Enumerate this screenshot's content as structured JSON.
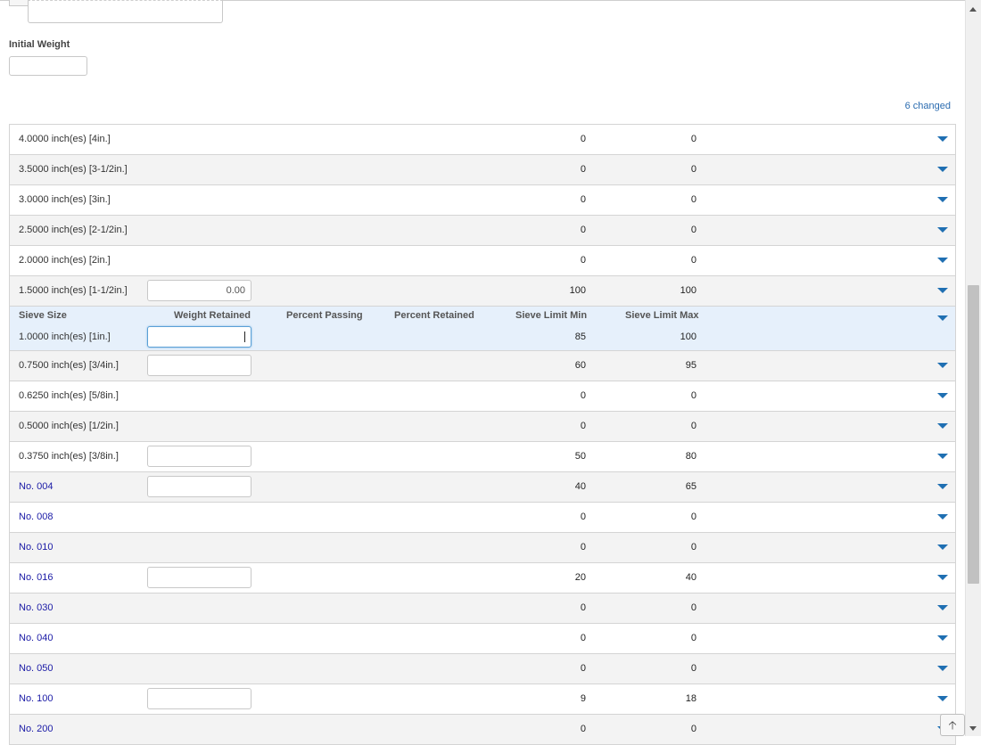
{
  "form": {
    "initial_weight_label": "Initial Weight",
    "initial_weight_value": "",
    "changed_text": "6 changed"
  },
  "table": {
    "headers": {
      "sieve_size": "Sieve Size",
      "weight_retained": "Weight Retained",
      "percent_passing": "Percent Passing",
      "percent_retained": "Percent Retained",
      "sieve_limit_min": "Sieve Limit Min",
      "sieve_limit_max": "Sieve Limit Max"
    },
    "rows": [
      {
        "size": "4.0000 inch(es) [4in.]",
        "input": null,
        "min": "0",
        "max": "0"
      },
      {
        "size": "3.5000 inch(es) [3-1/2in.]",
        "input": null,
        "min": "0",
        "max": "0"
      },
      {
        "size": "3.0000 inch(es) [3in.]",
        "input": null,
        "min": "0",
        "max": "0"
      },
      {
        "size": "2.5000 inch(es) [2-1/2in.]",
        "input": null,
        "min": "0",
        "max": "0"
      },
      {
        "size": "2.0000 inch(es) [2in.]",
        "input": null,
        "min": "0",
        "max": "0"
      },
      {
        "size": "1.5000 inch(es) [1-1/2in.]",
        "input": "0.00",
        "min": "100",
        "max": "100"
      },
      {
        "size": "1.0000 inch(es) [1in.]",
        "input": "",
        "min": "85",
        "max": "100"
      },
      {
        "size": "0.7500 inch(es) [3/4in.]",
        "input": "",
        "min": "60",
        "max": "95"
      },
      {
        "size": "0.6250 inch(es) [5/8in.]",
        "input": null,
        "min": "0",
        "max": "0"
      },
      {
        "size": "0.5000 inch(es) [1/2in.]",
        "input": null,
        "min": "0",
        "max": "0"
      },
      {
        "size": "0.3750 inch(es) [3/8in.]",
        "input": "",
        "min": "50",
        "max": "80"
      },
      {
        "size": "No. 004",
        "input": "",
        "min": "40",
        "max": "65"
      },
      {
        "size": "No. 008",
        "input": null,
        "min": "0",
        "max": "0"
      },
      {
        "size": "No. 010",
        "input": null,
        "min": "0",
        "max": "0"
      },
      {
        "size": "No. 016",
        "input": "",
        "min": "20",
        "max": "40"
      },
      {
        "size": "No. 030",
        "input": null,
        "min": "0",
        "max": "0"
      },
      {
        "size": "No. 040",
        "input": null,
        "min": "0",
        "max": "0"
      },
      {
        "size": "No. 050",
        "input": null,
        "min": "0",
        "max": "0"
      },
      {
        "size": "No. 100",
        "input": "",
        "min": "9",
        "max": "18"
      },
      {
        "size": "No. 200",
        "input": null,
        "min": "0",
        "max": "0"
      }
    ]
  },
  "icons": {
    "expand": "chevron-down-icon",
    "scroll_to_top": "arrow-up-icon"
  },
  "colors": {
    "accent": "#1f6fb2",
    "link": "#1a1aa6",
    "active_row": "#e6f0fb"
  }
}
